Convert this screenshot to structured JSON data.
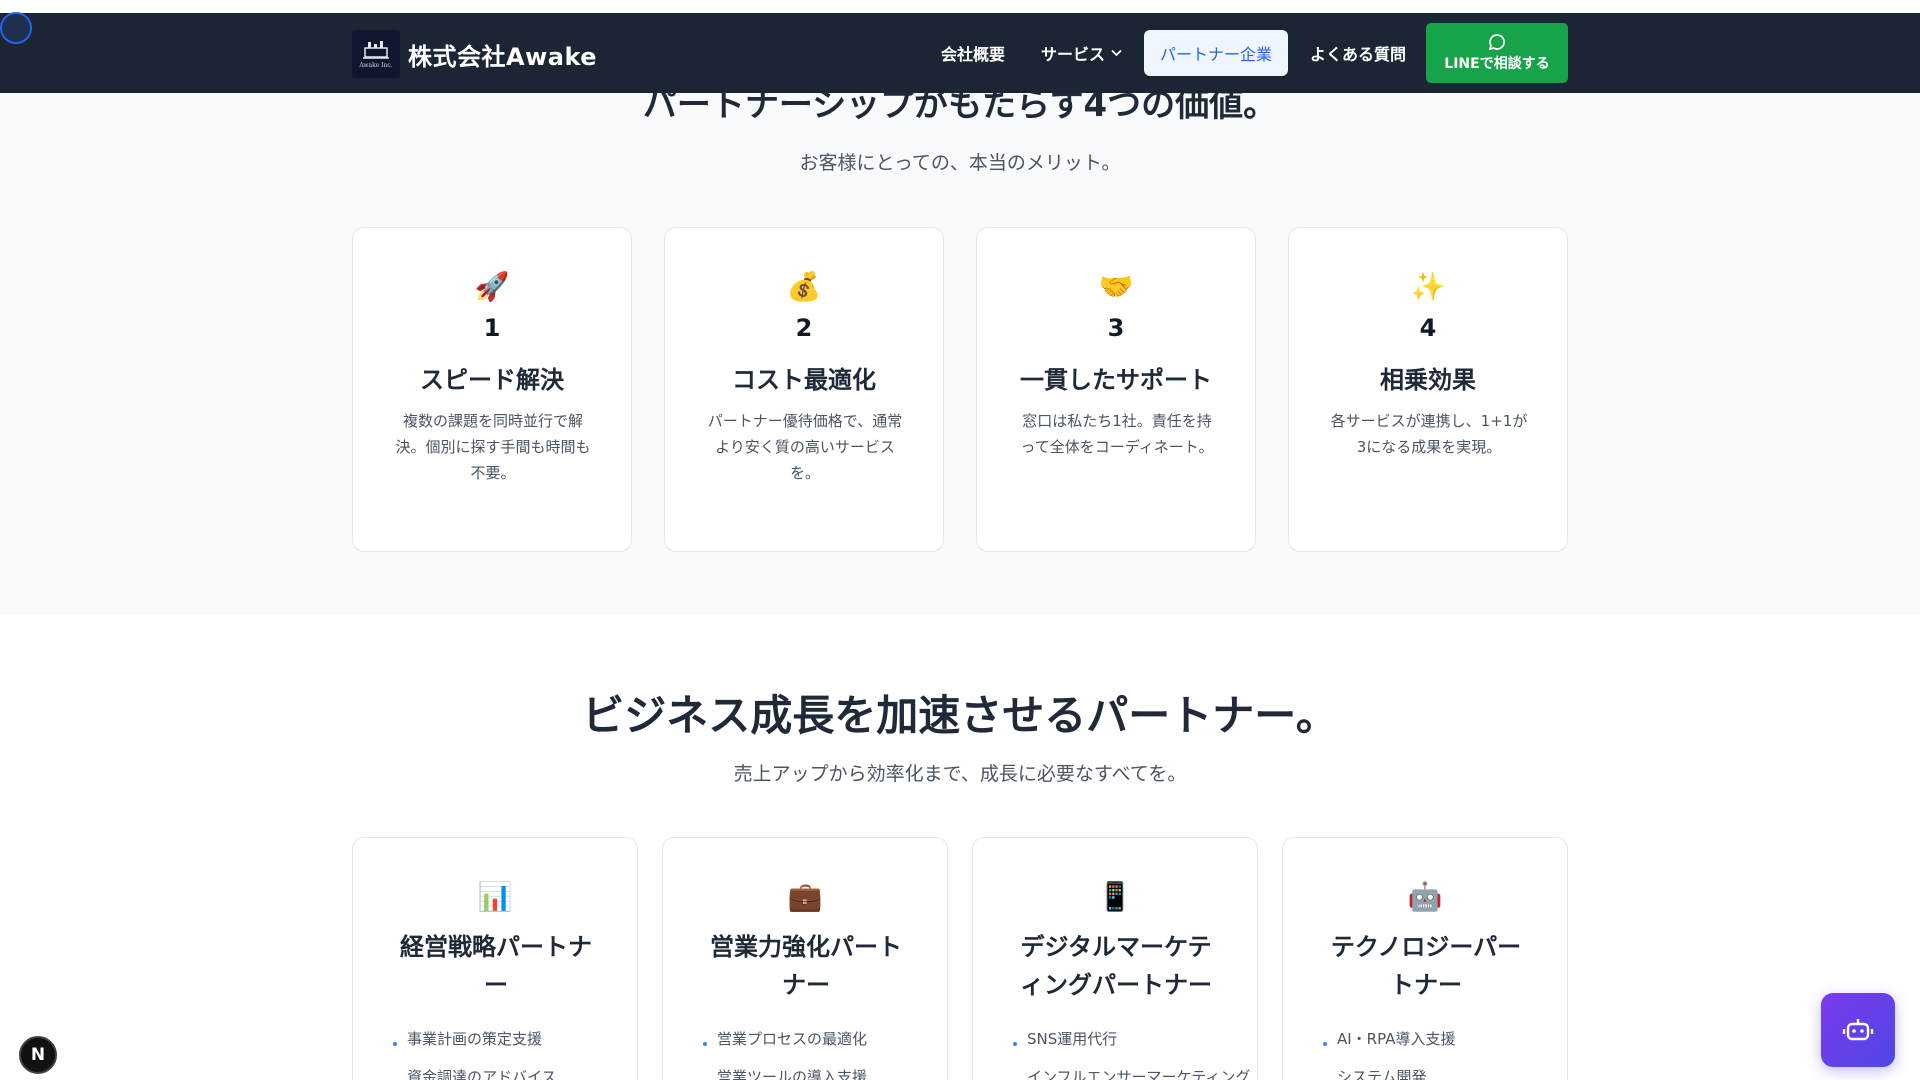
{
  "header": {
    "brand_name": "株式会社Awake",
    "logo_sub": "Awake Inc.",
    "nav": {
      "company": "会社概要",
      "services": "サービス",
      "partners": "パートナー企業",
      "faq": "よくある質問",
      "line_cta": "LINEで相談する"
    }
  },
  "values_section": {
    "title": "パートナーシップがもたらす4つの価値。",
    "subtitle": "お客様にとっての、本当のメリット。",
    "cards": [
      {
        "emoji": "🚀",
        "number": "1",
        "title": "スピード解決",
        "desc": "複数の課題を同時並行で解決。個別に探す手間も時間も不要。"
      },
      {
        "emoji": "💰",
        "number": "2",
        "title": "コスト最適化",
        "desc": "パートナー優待価格で、通常より安く質の高いサービスを。"
      },
      {
        "emoji": "🤝",
        "number": "3",
        "title": "一貫したサポート",
        "desc": "窓口は私たち1社。責任を持って全体をコーディネート。"
      },
      {
        "emoji": "✨",
        "number": "4",
        "title": "相乗効果",
        "desc": "各サービスが連携し、1+1が3になる成果を実現。"
      }
    ]
  },
  "partners_section": {
    "title": "ビジネス成長を加速させるパートナー。",
    "subtitle": "売上アップから効率化まで、成長に必要なすべてを。",
    "cards": [
      {
        "emoji": "📊",
        "title": "経営戦略パートナー",
        "items": [
          "事業計画の策定支援",
          "資金調達のアドバイス"
        ]
      },
      {
        "emoji": "💼",
        "title": "営業力強化パートナー",
        "items": [
          "営業プロセスの最適化",
          "営業ツールの導入支援"
        ]
      },
      {
        "emoji": "📱",
        "title": "デジタルマーケティングパートナー",
        "items": [
          "SNS運用代行",
          "インフルエンサーマーケティング"
        ]
      },
      {
        "emoji": "🤖",
        "title": "テクノロジーパートナー",
        "items": [
          "AI・RPA導入支援",
          "システム開発"
        ]
      }
    ]
  },
  "overlays": {
    "next_badge": "N"
  }
}
